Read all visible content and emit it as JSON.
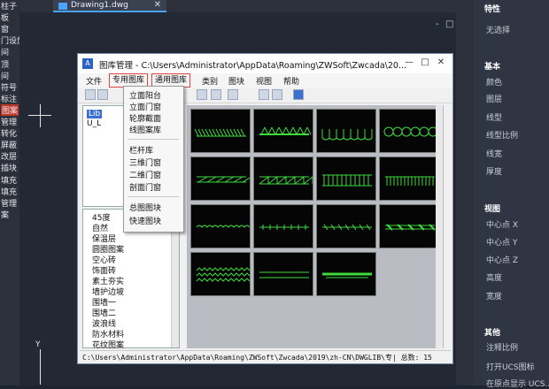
{
  "tab": {
    "title": "Drawing1.dwg",
    "close": "✕"
  },
  "left_strip": [
    "柱子",
    "板",
    "窗",
    "门设施",
    "间",
    "顶",
    "间",
    "符号",
    "标注",
    "图案",
    "管理",
    "转化",
    "屏蔽",
    "改层",
    "插块",
    "填充",
    "填充",
    "管理",
    "案"
  ],
  "canvas_controls": [
    "-",
    "□",
    "✕"
  ],
  "props": {
    "title": "特性",
    "selection": "无选择",
    "sections": [
      {
        "name": "基本",
        "items": [
          "颜色",
          "图层",
          "线型",
          "线型比例",
          "线宽",
          "厚度"
        ]
      },
      {
        "name": "视图",
        "items": [
          "中心点 X",
          "中心点 Y",
          "中心点 Z",
          "高度",
          "宽度"
        ]
      },
      {
        "name": "其他",
        "items": [
          "注释比例",
          "打开UCS图标",
          "在原点显示 UCS..."
        ]
      }
    ]
  },
  "dialog": {
    "title": "图库管理 - C:\\Users\\Administrator\\AppData\\Roaming\\ZWSoft\\Zwcada\\20...",
    "icon": "A",
    "window_buttons": [
      "—",
      "□",
      "✕"
    ],
    "menu": [
      "文件",
      "专用图库",
      "通用图库",
      "类别",
      "图块",
      "视图",
      "帮助"
    ],
    "tree": [
      "Lib",
      "U_L"
    ],
    "list": [
      "45度",
      "自然",
      "保温层",
      "圆圈图案",
      "空心砖",
      "饰面砖",
      "素土夯实",
      "墙护边坡",
      "围墙一",
      "围墙二",
      "波浪线",
      "防水材料",
      "花纹图案"
    ],
    "status": "C:\\Users\\Administrator\\AppData\\Roaming\\ZWSoft\\Zwcada\\2019\\zh-CN\\DWGLIB\\专| 总数:  15"
  },
  "dropdown": [
    "立面阳台",
    "立面门窗",
    "轮廓截面",
    "线图案库",
    "栏杆库",
    "三维门窗",
    "二维门窗",
    "剖面门窗",
    "总图图块",
    "快速图块"
  ],
  "colors": {
    "line": "#3ddc3d",
    "cell_bg": "#050505",
    "accent": "#4aa3ff",
    "highlight": "#e0463c"
  }
}
